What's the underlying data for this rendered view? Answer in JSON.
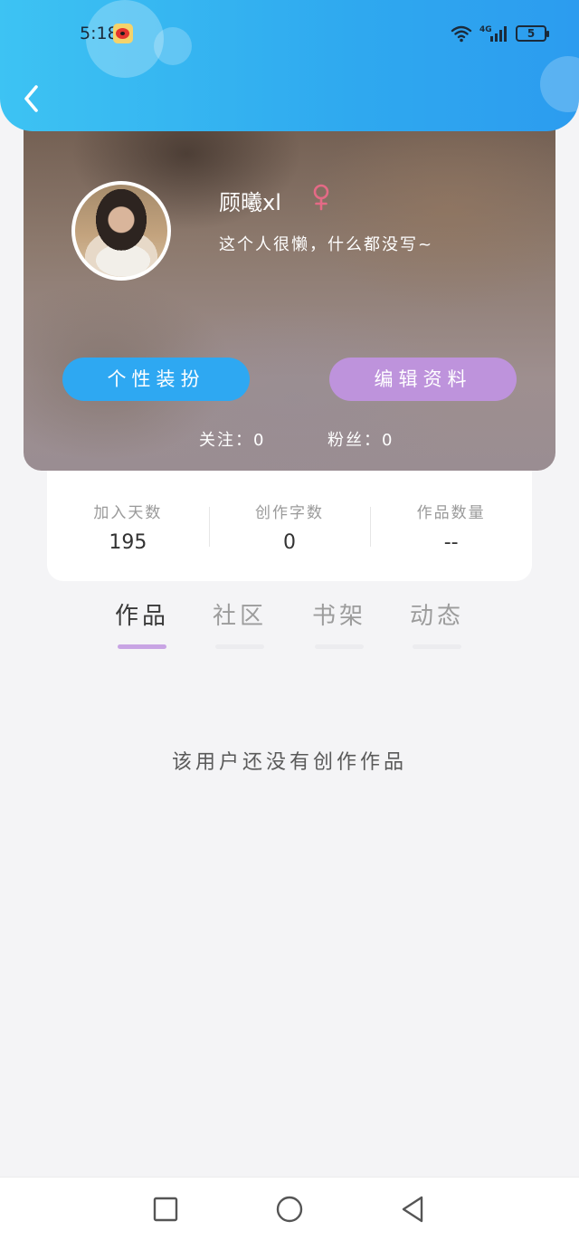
{
  "status_bar": {
    "time": "5:18",
    "battery": "5",
    "network": "4G"
  },
  "profile": {
    "username": "顾曦xl",
    "gender": "female",
    "bio": "这个人很懒，什么都没写~",
    "style_button": "个性装扮",
    "edit_button": "编辑资料",
    "following": "关注：0",
    "fans": "粉丝：0"
  },
  "stats": [
    {
      "label": "加入天数",
      "value": "195"
    },
    {
      "label": "创作字数",
      "value": "0"
    },
    {
      "label": "作品数量",
      "value": "--"
    }
  ],
  "tabs": [
    {
      "label": "作品",
      "active": true
    },
    {
      "label": "社区",
      "active": false
    },
    {
      "label": "书架",
      "active": false
    },
    {
      "label": "动态",
      "active": false
    }
  ],
  "empty_message": "该用户还没有创作作品",
  "colors": {
    "header_blue": "#2fa9ef",
    "style_button": "#2ea8f2",
    "edit_button": "#be93dc",
    "tab_underline": "#c8a4e4",
    "female_icon": "#e46a86"
  },
  "icons": {
    "back": "chevron-left-icon",
    "gender": "female-icon",
    "nav": [
      "square-icon",
      "circle-icon",
      "triangle-back-icon"
    ]
  }
}
